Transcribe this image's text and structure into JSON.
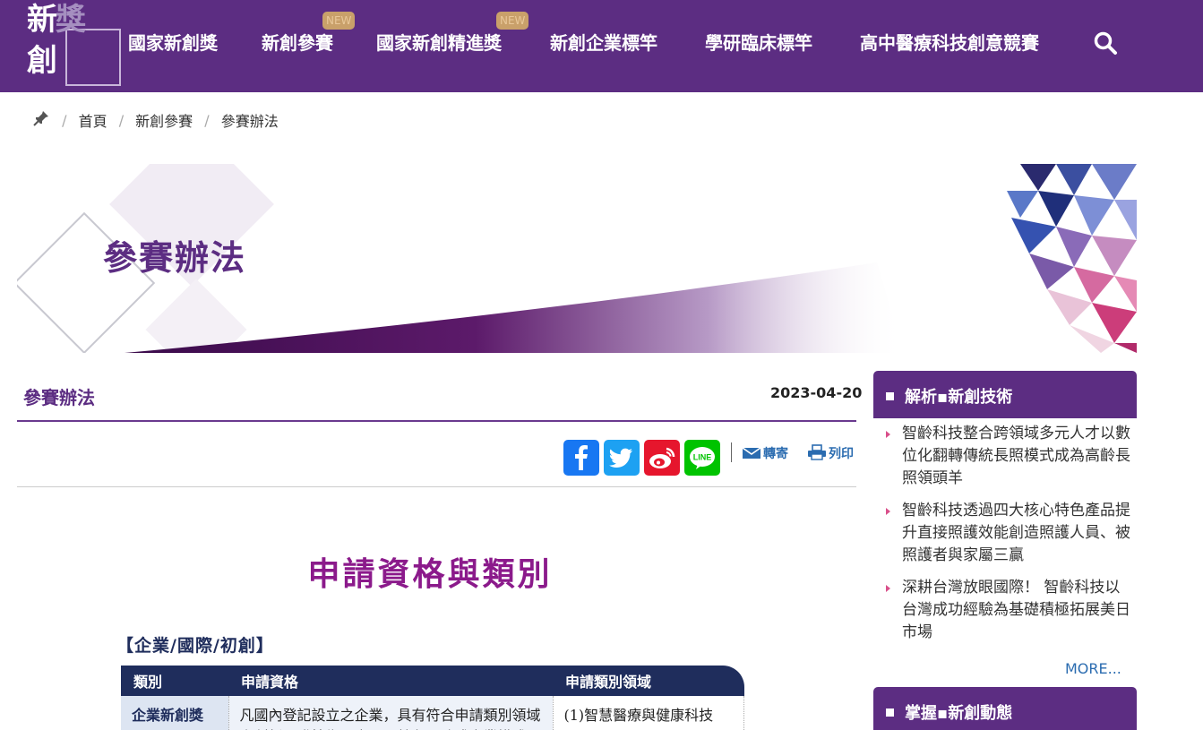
{
  "site": {
    "logo_chars": [
      "新",
      "創",
      "創",
      "獎"
    ]
  },
  "nav": {
    "items": [
      {
        "label": "國家新創獎",
        "badge": ""
      },
      {
        "label": "新創參賽",
        "badge": "NEW"
      },
      {
        "label": "國家新創精進獎",
        "badge": "NEW"
      },
      {
        "label": "新創企業標竿",
        "badge": ""
      },
      {
        "label": "學研臨床標竿",
        "badge": ""
      },
      {
        "label": "高中醫療科技創意競賽",
        "badge": ""
      }
    ],
    "search_icon": "search-icon"
  },
  "breadcrumb": {
    "icon": "pin-icon",
    "items": [
      "首頁",
      "新創參賽",
      "參賽辦法"
    ]
  },
  "banner": {
    "title": "參賽辦法"
  },
  "article": {
    "title": "參賽辦法",
    "date": "2023-04-20",
    "share": [
      "facebook-icon",
      "twitter-icon",
      "weibo-icon",
      "line-icon"
    ],
    "forward_label": "轉寄",
    "print_label": "列印",
    "heading": "申請資格與類別",
    "subheading": "【企業/國際/初創】",
    "table": {
      "headers": [
        "類別",
        "申請資格",
        "申請類別領域"
      ],
      "rows": [
        [
          "企業新創獎",
          "凡國內登記設立之企業，具有符合申請類別領域之創新研發技術、產品、特色服務或產業模式",
          "(1)智慧醫療與健康科技"
        ]
      ]
    }
  },
  "sidebar": {
    "box1_title": "解析▪新創技術",
    "box1_items": [
      "智齡科技整合跨領域多元人才以數位化翻轉傳統長照模式成為高齡長照領頭羊",
      "智齡科技透過四大核心特色產品提升直接照護效能創造照護人員、被照護者與家屬三贏",
      "深耕台灣放眼國際！ 智齡科技以台灣成功經驗為基礎積極拓展美日市場"
    ],
    "more_label": "MORE...",
    "box2_title": "掌握▪新創動態"
  },
  "colors": {
    "brand_purple": "#5c2d82",
    "heading_magenta": "#8b1a8b",
    "table_navy": "#1f2d5c",
    "link_blue": "#2b6cb0"
  }
}
